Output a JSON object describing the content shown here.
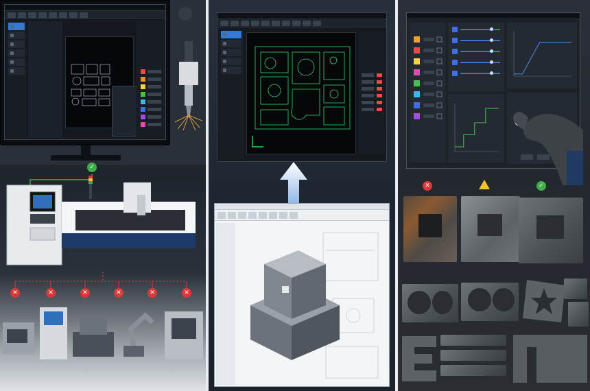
{
  "colors": {
    "success": "#3fae49",
    "error": "#d83a3a",
    "warning": "#f1c232",
    "accent": "#2f7bd8",
    "cad_line": "#39d36b",
    "laser_spark": "#ffb347"
  },
  "left_panel": {
    "top_status_icon": "check-icon",
    "incompatible_icons": [
      "x-icon",
      "x-icon",
      "x-icon",
      "x-icon",
      "x-icon",
      "x-icon"
    ],
    "cnc_software": {
      "sidebar_items": [
        "",
        "",
        "",
        "",
        "",
        ""
      ],
      "layer_colors": [
        "#e94b4b",
        "#f28a2e",
        "#f5d33a",
        "#47c24f",
        "#38b7e8",
        "#3f6ee8",
        "#a64ae6",
        "#e64aa8"
      ]
    }
  },
  "middle_panel": {
    "upload_arrow_icon": "arrow-up-icon",
    "nesting_window": {
      "sidebar_items": [
        "",
        "",
        "",
        "",
        ""
      ]
    },
    "cad_window": {
      "view": "3d-part-view"
    }
  },
  "right_panel": {
    "status_icons": [
      "x-icon",
      "warning-icon",
      "check-icon"
    ],
    "param_swatches": [
      "#f0a030",
      "#e94b4b",
      "#f5d33a",
      "#e64aa8",
      "#47c24f",
      "#38b7e8",
      "#3f6ee8",
      "#a64ae6"
    ],
    "power_curve": [
      [
        0,
        0.05
      ],
      [
        0.15,
        0.05
      ],
      [
        0.45,
        0.75
      ],
      [
        1,
        0.75
      ]
    ],
    "step_curve": [
      [
        0,
        0.1
      ],
      [
        0.2,
        0.1
      ],
      [
        0.2,
        0.35
      ],
      [
        0.45,
        0.35
      ],
      [
        0.45,
        0.6
      ],
      [
        0.7,
        0.6
      ],
      [
        0.7,
        0.9
      ],
      [
        1,
        0.9
      ]
    ]
  }
}
